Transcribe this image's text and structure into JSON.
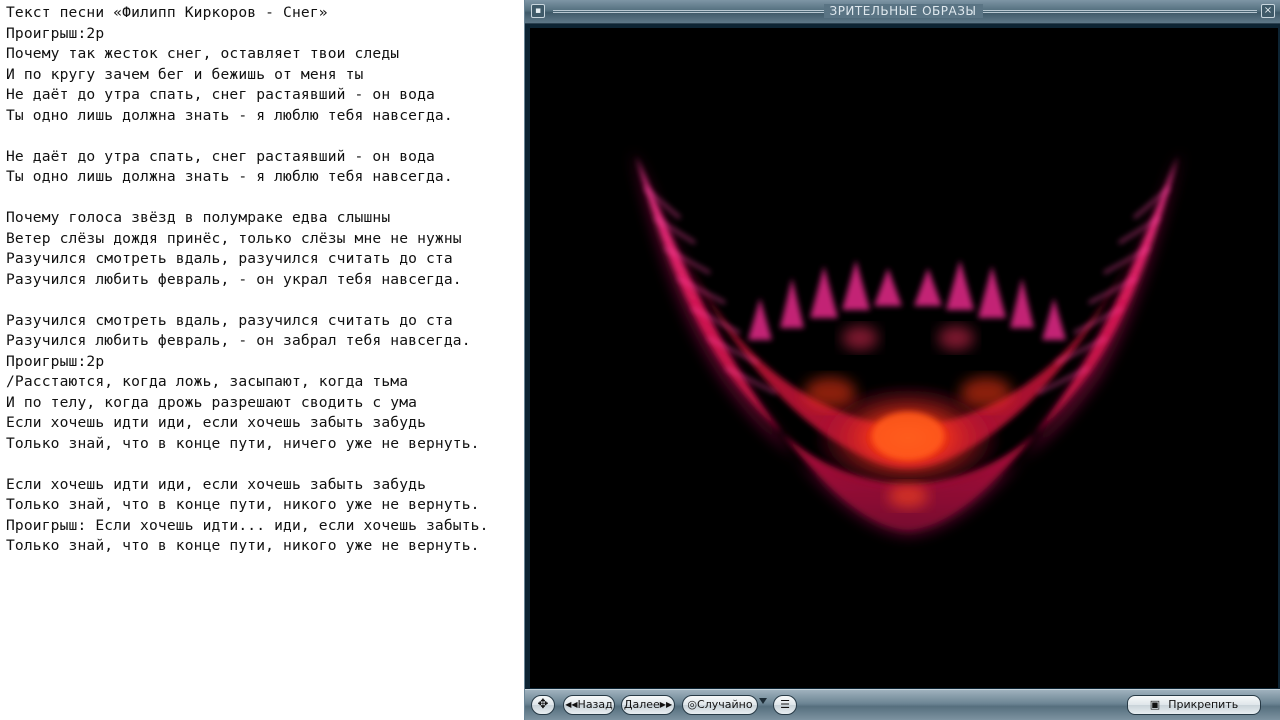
{
  "lyrics": {
    "lines": [
      "Текст песни «Филипп Киркоров - Снег»",
      "Проигрыш:2р",
      "Почему так жесток снег, оставляет твои следы",
      "И по кругу зачем бег и бежишь от меня ты",
      "Не даёт до утра спать, снег растаявший - он вода",
      "Ты одно лишь должна знать - я люблю тебя навсегда.",
      "",
      "Не даёт до утра спать, снег растаявший - он вода",
      "Ты одно лишь должна знать - я люблю тебя навсегда.",
      "",
      "Почему голоса звёзд в полумраке едва слышны",
      "Ветер слёзы дождя принёс, только слёзы мне не нужны",
      "Разучился смотреть вдаль, разучился считать до ста",
      "Разучился любить февраль, - он украл тебя навсегда.",
      "",
      "Разучился смотреть вдаль, разучился считать до ста",
      "Разучился любить февраль, - он забрал тебя навсегда.",
      "Проигрыш:2р",
      "/Расстаются, когда ложь, засыпают, когда тьма",
      "И по телу, когда дрожь разрешают сводить с ума",
      "Если хочешь идти иди, если хочешь забыть забудь",
      "Только знай, что в конце пути, ничего уже не вернуть.",
      "",
      "Если хочешь идти иди, если хочешь забыть забудь",
      "Только знай, что в конце пути, никого уже не вернуть.",
      "Проигрыш: Если хочешь идти... иди, если хочешь забыть.",
      "Только знай, что в конце пути, никого уже не вернуть."
    ]
  },
  "viz_window": {
    "title": "ЗРИТЕЛЬНЫЕ ОБРАЗЫ",
    "visual": {
      "description_icon": "fractal-flame",
      "colors": {
        "background": "#000000",
        "outer": "#c8105a",
        "inner": "#ff3a10",
        "core": "#ff6a20"
      }
    },
    "controls": {
      "move_icon": "move-icon",
      "back_label": "Назад",
      "next_label": "Далее",
      "random_label": "Случайно",
      "options_icon": "list-menu-icon",
      "pin_label": "Прикрепить"
    }
  }
}
